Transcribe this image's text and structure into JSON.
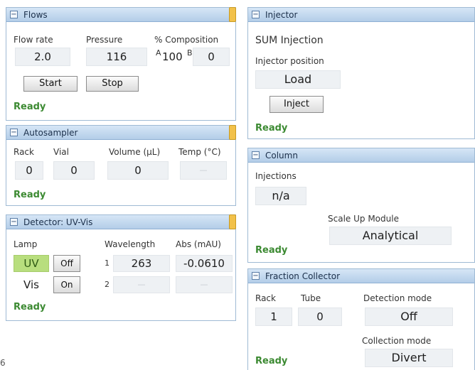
{
  "flows": {
    "title": "Flows",
    "flow_rate_label": "Flow rate",
    "pressure_label": "Pressure",
    "composition_label": "% Composition",
    "flow_rate": "2.0",
    "pressure": "116",
    "a_label": "A",
    "a_value": "100",
    "b_label": "B",
    "b_value": "0",
    "start_label": "Start",
    "stop_label": "Stop",
    "status": "Ready"
  },
  "autosampler": {
    "title": "Autosampler",
    "rack_label": "Rack",
    "vial_label": "Vial",
    "volume_label": "Volume (µL)",
    "temp_label": "Temp (°C)",
    "rack": "0",
    "vial": "0",
    "volume": "0",
    "temp": "—",
    "status": "Ready"
  },
  "detector": {
    "title": "Detector: UV-Vis",
    "lamp_label": "Lamp",
    "wavelength_label": "Wavelength",
    "abs_label": "Abs (mAU)",
    "uv_label": "UV",
    "uv_button": "Off",
    "vis_label": "Vis",
    "vis_button": "On",
    "ch1": "1",
    "ch2": "2",
    "wavelength1": "263",
    "abs1": "-0.0610",
    "wavelength2": "—",
    "abs2": "—",
    "status": "Ready"
  },
  "injector": {
    "title": "Injector",
    "name": "SUM Injection",
    "position_label": "Injector position",
    "position": "Load",
    "inject_label": "Inject",
    "status": "Ready"
  },
  "column": {
    "title": "Column",
    "injections_label": "Injections",
    "injections": "n/a",
    "scale_label": "Scale Up Module",
    "scale_value": "Analytical",
    "status": "Ready"
  },
  "fraction": {
    "title": "Fraction Collector",
    "rack_label": "Rack",
    "tube_label": "Tube",
    "detection_label": "Detection mode",
    "rack": "1",
    "tube": "0",
    "detection": "Off",
    "collection_label": "Collection mode",
    "collection": "Divert",
    "status": "Ready"
  },
  "footer_number": "6",
  "colors": {
    "ready": "#3c8a32",
    "header": "#b3cde8",
    "grip": "#f2c14a",
    "uv_on": "#b8de7e"
  }
}
